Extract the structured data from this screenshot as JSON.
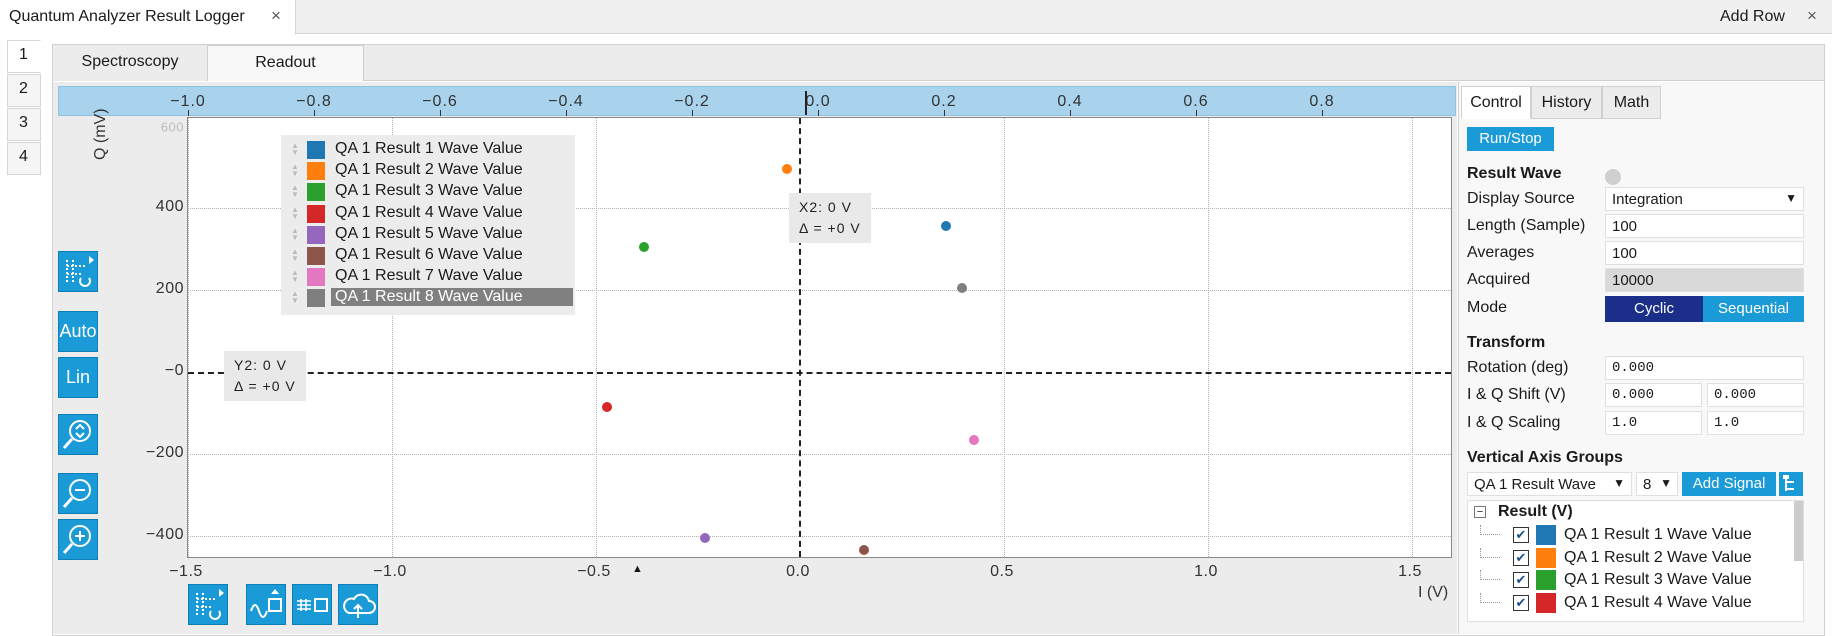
{
  "app": {
    "tab_title": "Quantum Analyzer Result Logger",
    "close": "×",
    "add_row": "Add Row",
    "row_close": "×"
  },
  "row_tabs": [
    "1",
    "2",
    "3",
    "4"
  ],
  "subtabs": {
    "spectroscopy": "Spectroscopy",
    "readout": "Readout"
  },
  "plot": {
    "top_axis_ticks": [
      "−1.0",
      "−0.8",
      "−0.6",
      "−0.4",
      "−0.2",
      "0.0",
      "0.2",
      "0.4",
      "0.6",
      "0.8"
    ],
    "y_ticks": [
      "400",
      "200",
      "−0",
      "−200",
      "−400"
    ],
    "y_tick_partial": "600",
    "x_ticks": [
      "−1.5",
      "−1.0",
      "−0.5",
      "0.0",
      "0.5",
      "1.0",
      "1.5"
    ],
    "ylabel": "Q (mV)",
    "xlabel": "I (V)",
    "cursor_x": {
      "line1": "X2: 0 V",
      "line2": "Δ = +0 V"
    },
    "cursor_y": {
      "line1": "Y2: 0 V",
      "line2": "Δ = +0 V"
    }
  },
  "legend": [
    {
      "label": "QA 1 Result 1 Wave Value",
      "color": "#1f77b4"
    },
    {
      "label": "QA 1 Result 2 Wave Value",
      "color": "#ff7f0e"
    },
    {
      "label": "QA 1 Result 3 Wave Value",
      "color": "#2ca02c"
    },
    {
      "label": "QA 1 Result 4 Wave Value",
      "color": "#d62728"
    },
    {
      "label": "QA 1 Result 5 Wave Value",
      "color": "#9467bd"
    },
    {
      "label": "QA 1 Result 6 Wave Value",
      "color": "#8c564b"
    },
    {
      "label": "QA 1 Result 7 Wave Value",
      "color": "#e377c2"
    },
    {
      "label": "QA 1 Result 8 Wave Value",
      "color": "#7f7f7f"
    }
  ],
  "chart_data": {
    "type": "scatter",
    "xlabel": "I (V)",
    "ylabel": "Q (mV)",
    "xlim": [
      -1.5,
      1.5
    ],
    "ylim": [
      -450,
      600
    ],
    "series": [
      {
        "name": "QA 1 Result 1 Wave Value",
        "x": 0.36,
        "y": 355
      },
      {
        "name": "QA 1 Result 2 Wave Value",
        "x": -0.03,
        "y": 495
      },
      {
        "name": "QA 1 Result 3 Wave Value",
        "x": -0.38,
        "y": 305
      },
      {
        "name": "QA 1 Result 4 Wave Value",
        "x": -0.47,
        "y": -85
      },
      {
        "name": "QA 1 Result 5 Wave Value",
        "x": -0.23,
        "y": -405
      },
      {
        "name": "QA 1 Result 6 Wave Value",
        "x": 0.16,
        "y": -435
      },
      {
        "name": "QA 1 Result 7 Wave Value",
        "x": 0.43,
        "y": -165
      },
      {
        "name": "QA 1 Result 8 Wave Value",
        "x": 0.4,
        "y": 205
      }
    ]
  },
  "toolbar": {
    "auto": "Auto",
    "lin": "Lin"
  },
  "right": {
    "tabs": [
      "Control",
      "History",
      "Math"
    ],
    "run_stop": "Run/Stop",
    "result_wave": "Result Wave",
    "display_source_label": "Display Source",
    "display_source_value": "Integration",
    "length_label": "Length (Sample)",
    "length_value": "100",
    "averages_label": "Averages",
    "averages_value": "100",
    "acquired_label": "Acquired",
    "acquired_value": "10000",
    "mode_label": "Mode",
    "mode_cyclic": "Cyclic",
    "mode_sequential": "Sequential",
    "transform": "Transform",
    "rotation_label": "Rotation (deg)",
    "rotation_value": "0.000",
    "shift_label": "I & Q Shift (V)",
    "shift_i": "0.000",
    "shift_q": "0.000",
    "scaling_label": "I & Q Scaling",
    "scaling_i": "1.0",
    "scaling_q": "1.0",
    "vag": "Vertical Axis Groups",
    "vag_select": "QA 1 Result Wave",
    "vag_count": "8",
    "add_signal": "Add Signal",
    "tree_root": "Result (V)",
    "tree_items": [
      {
        "label": "QA 1 Result 1 Wave Value",
        "color": "#1f77b4"
      },
      {
        "label": "QA 1 Result 2 Wave Value",
        "color": "#ff7f0e"
      },
      {
        "label": "QA 1 Result 3 Wave Value",
        "color": "#2ca02c"
      },
      {
        "label": "QA 1 Result 4 Wave Value",
        "color": "#d62728"
      }
    ]
  }
}
